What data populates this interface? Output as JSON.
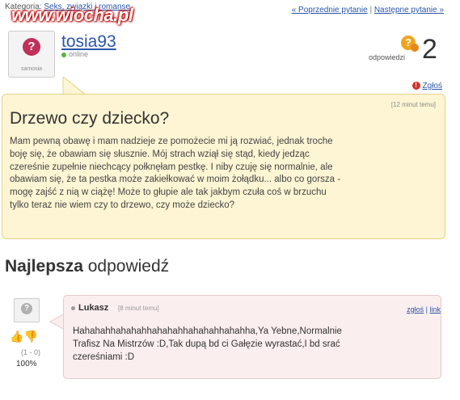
{
  "breadcrumb": {
    "prefix": "Kategoria:",
    "category": "Seks, związki i romanse"
  },
  "watermark": "www.wiocha.pl",
  "nav": {
    "prev": "« Poprzednie pytanie",
    "separator": "|",
    "next": "Następne pytanie »"
  },
  "asker": {
    "avatar_caption": "samosia",
    "username": "tosia93",
    "status": "online"
  },
  "answers": {
    "label": "odpowiedzi",
    "count": "2"
  },
  "report": "Zgłoś",
  "question": {
    "time": "[12 minut temu]",
    "title": "Drzewo czy dziecko?",
    "body": "Mam pewną obawę i mam nadzieje ze pomożecie mi ją rozwiać, jednak troche\nboję się, że obawiam się słusznie. Mój strach wziął się stąd, kiedy jedząc\nczereśnie zupełnie niechcący połknęłam pestkę. I niby czuję się normalnie, ale\nobawiam się, że ta pestka może zakiełkować w moim żołądku... albo co gorsza -\nmogę zajść z nią w ciążę! Może to głupie ale tak jakbym czuła coś w brzuchu\ntylko teraz nie wiem czy to drzewo, czy może dziecko?"
  },
  "best_answer": {
    "heading_bold": "Najlepsza",
    "heading_rest": "odpowiedź",
    "author": "Lukasz",
    "time": "[8 minut temu]",
    "report_link": "zgłoś",
    "separator": "|",
    "link": "link",
    "body": "Hahahahhahahahhahahahhahahahhahahha,Ya Yebne,Normalnie\nTrafisz Na Mistrzów :D,Tak dupą bd ci Gałęzie wyrastać,I bd srać\nczereśniami :D",
    "votes": "(1 - 0)",
    "percent": "100%"
  },
  "colors": {
    "link": "#2a55a8",
    "question_bg": "#fdf5d3",
    "answer_bg": "#fbeeee",
    "online": "#59b33b"
  },
  "icons": [
    "samosia-logo-icon",
    "answers-icon",
    "report-icon",
    "thumb-up-icon",
    "thumb-down-icon"
  ]
}
